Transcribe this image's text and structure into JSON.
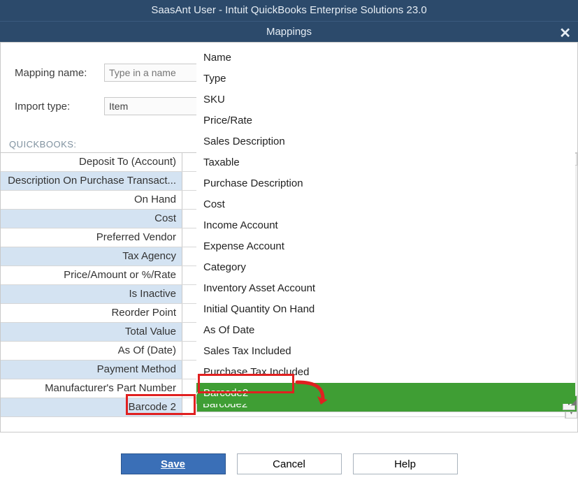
{
  "window": {
    "title": "SaasAnt User  -  Intuit QuickBooks Enterprise Solutions 23.0",
    "subtitle": "Mappings"
  },
  "form": {
    "mapping_name_label": "Mapping name:",
    "mapping_name_placeholder": "Type in a name",
    "import_type_label": "Import type:",
    "import_type_value": "Item"
  },
  "table": {
    "header": "QUICKBOOKS:",
    "rows": [
      "Deposit To (Account)",
      "Description On Purchase Transact...",
      "On Hand",
      "Cost",
      "Preferred Vendor",
      "Tax Agency",
      "Price/Amount or %/Rate",
      "Is Inactive",
      "Reorder Point",
      "Total Value",
      "As Of (Date)",
      "Payment Method",
      "Manufacturer's Part Number",
      "Barcode 2"
    ]
  },
  "dropdown": {
    "options": [
      "Name",
      "Type",
      "SKU",
      "Price/Rate",
      "Sales Description",
      "Taxable",
      "Purchase Description",
      "Cost",
      "Income Account",
      "Expense Account",
      "Category",
      "Inventory Asset Account",
      "Initial Quantity On Hand",
      "As Of Date",
      "Sales Tax Included",
      "Purchase Tax Included",
      "Barcode2"
    ],
    "selected": "Barcode2"
  },
  "combo_selected": "Barcode2",
  "buttons": {
    "save": "Save",
    "cancel": "Cancel",
    "help": "Help"
  }
}
